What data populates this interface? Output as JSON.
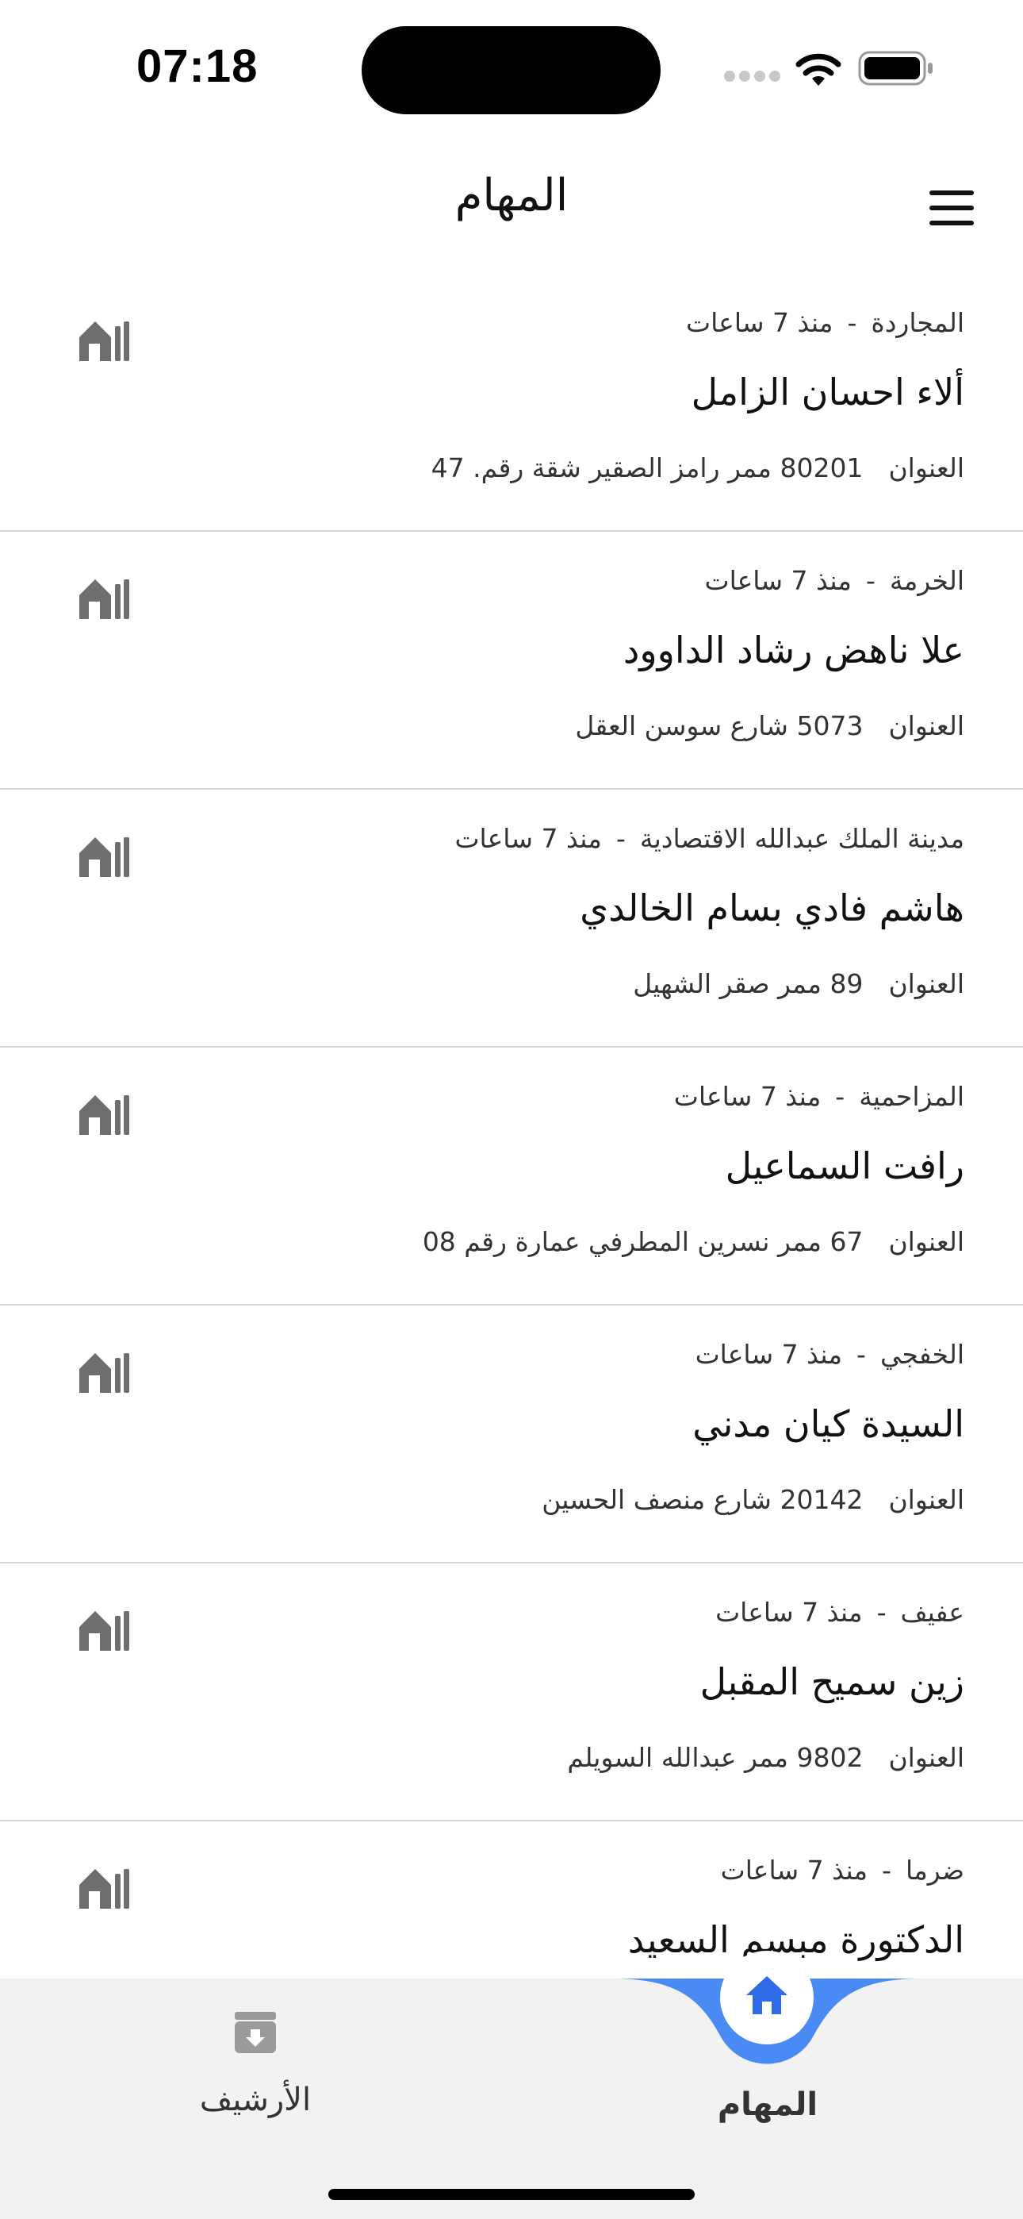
{
  "status_bar": {
    "time": "07:18"
  },
  "header": {
    "title": "المهام"
  },
  "tasks": [
    {
      "city": "المجاردة",
      "time_ago": "منذ 7 ساعات",
      "name": "ألاء احسان الزامل",
      "address_label": "العنوان",
      "address": "80201 ممر رامز الصقير شقة رقم. 47"
    },
    {
      "city": "الخرمة",
      "time_ago": "منذ 7 ساعات",
      "name": "علا ناهض رشاد الداوود",
      "address_label": "العنوان",
      "address": "5073 شارع سوسن العقل"
    },
    {
      "city": "مدينة الملك عبدالله الاقتصادية",
      "time_ago": "منذ 7 ساعات",
      "name": "هاشم فادي بسام الخالدي",
      "address_label": "العنوان",
      "address": "89 ممر صقر الشهيل"
    },
    {
      "city": "المزاحمية",
      "time_ago": "منذ 7 ساعات",
      "name": "رافت السماعيل",
      "address_label": "العنوان",
      "address": "67 ممر نسرين المطرفي عمارة رقم 08"
    },
    {
      "city": "الخفجي",
      "time_ago": "منذ 7 ساعات",
      "name": "السيدة كيان مدني",
      "address_label": "العنوان",
      "address": "20142 شارع منصف الحسين"
    },
    {
      "city": "عفيف",
      "time_ago": "منذ 7 ساعات",
      "name": "زين سميح المقبل",
      "address_label": "العنوان",
      "address": "9802 ممر عبدالله السويلم"
    },
    {
      "city": "ضرما",
      "time_ago": "منذ 7 ساعات",
      "name": "الدكتورة مبسم السعيد",
      "address_label": "العنوان",
      "address": ""
    }
  ],
  "bottom_nav": {
    "tasks_label": "المهام",
    "archive_label": "الأرشيف",
    "active": "tasks",
    "accent_color": "#4a8af4"
  }
}
